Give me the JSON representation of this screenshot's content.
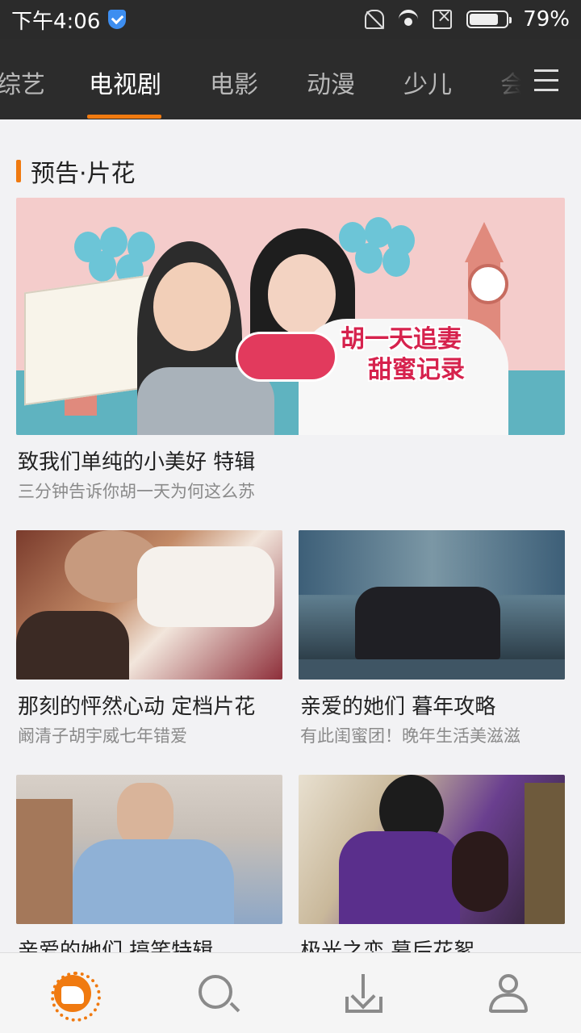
{
  "status_bar": {
    "time": "下午4:06",
    "battery": "79%",
    "battery_level": 0.79
  },
  "nav": {
    "tabs": [
      "综艺",
      "电视剧",
      "电影",
      "动漫",
      "少儿",
      "会"
    ],
    "active_tab": "电视剧"
  },
  "section": {
    "title": "预告·片花"
  },
  "hero": {
    "title": "致我们单纯的小美好 特辑",
    "subtitle": "三分钟告诉你胡一天为何这么苏",
    "badge_line1": "胡一天追妻",
    "badge_line2": "甜蜜记录"
  },
  "cards": [
    {
      "title": "那刻的怦然心动 定档片花",
      "subtitle": "阚清子胡宇威七年错爱"
    },
    {
      "title": "亲爱的她们 暮年攻略",
      "subtitle": "有此闺蜜团！晚年生活美滋滋"
    },
    {
      "title": "亲爱的她们 搞笑特辑",
      "subtitle": ""
    },
    {
      "title": "极光之恋 幕后花絮",
      "subtitle": ""
    }
  ],
  "colors": {
    "accent": "#f07a10",
    "nav_bg": "#2c2c2c",
    "status_bg": "#2b2b2b"
  },
  "bottom_bar": {
    "icons": [
      "home-icon",
      "search-icon",
      "download-icon",
      "user-icon"
    ]
  }
}
